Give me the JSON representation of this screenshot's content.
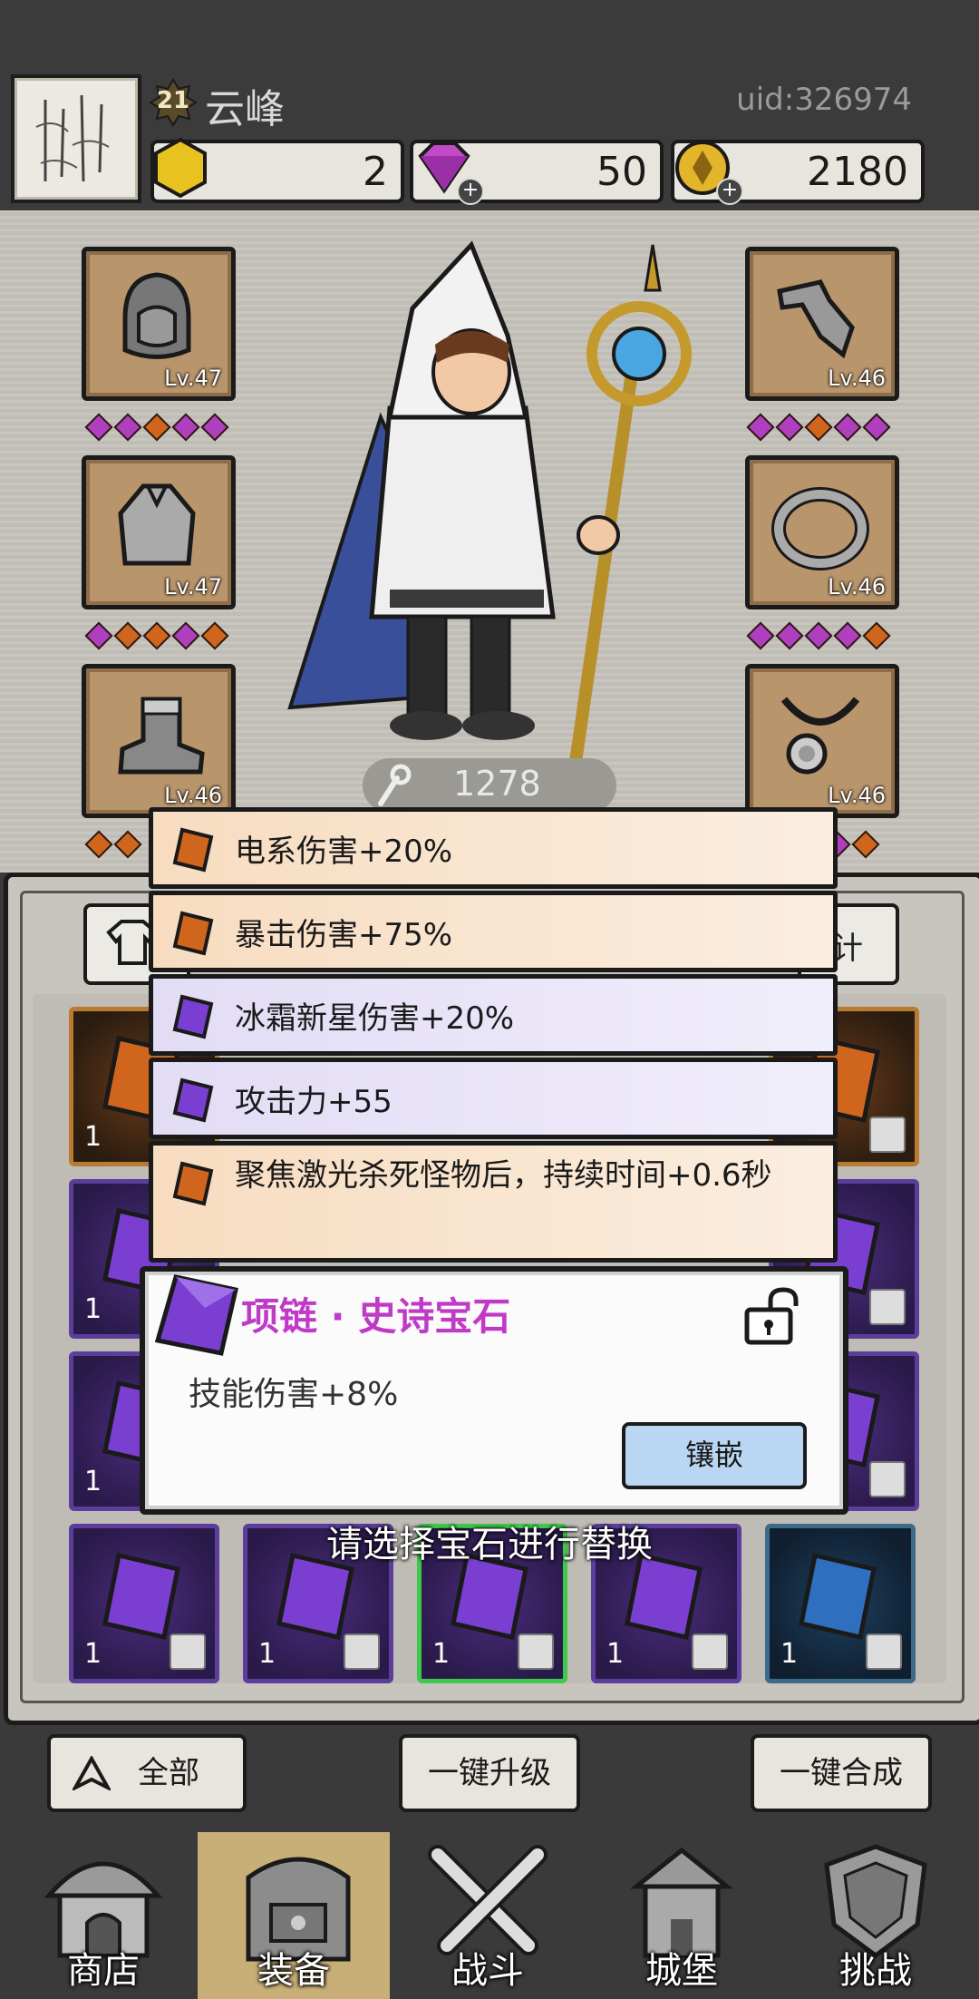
{
  "header": {
    "level": "21",
    "player_name": "云峰",
    "uid": "uid:326974",
    "resources": [
      {
        "icon": "gold-hexagon-icon",
        "value": "2"
      },
      {
        "icon": "diamond-icon",
        "value": "50"
      },
      {
        "icon": "coin-icon",
        "value": "2180"
      }
    ]
  },
  "equipment": {
    "left": [
      {
        "item": "helmet-icon",
        "level": "Lv.47",
        "dots": [
          "purple",
          "purple",
          "orange",
          "purple",
          "purple"
        ]
      },
      {
        "item": "cape-icon",
        "level": "Lv.47",
        "dots": [
          "purple",
          "orange",
          "orange",
          "purple",
          "orange"
        ]
      },
      {
        "item": "boot-icon",
        "level": "Lv.46",
        "dots": [
          "orange",
          "orange"
        ]
      }
    ],
    "right": [
      {
        "item": "bracer-icon",
        "level": "Lv.46",
        "dots": [
          "purple",
          "purple",
          "orange",
          "purple",
          "purple"
        ]
      },
      {
        "item": "ring-icon",
        "level": "Lv.46",
        "dots": [
          "purple",
          "purple",
          "purple",
          "purple",
          "orange"
        ]
      },
      {
        "item": "necklace-icon",
        "level": "Lv.46",
        "dots": [
          "purple",
          "orange"
        ]
      }
    ],
    "power": "1278"
  },
  "affixes": [
    {
      "color": "orange",
      "text": "电系伤害+20%"
    },
    {
      "color": "orange",
      "text": "暴击伤害+75%"
    },
    {
      "color": "purple",
      "text": "冰霜新星伤害+20%"
    },
    {
      "color": "purple",
      "text": "攻击力+55"
    },
    {
      "color": "orange",
      "text": "聚焦激光杀死怪物后，持续时间+0.6秒"
    }
  ],
  "inventory": {
    "tab_right_label": "计",
    "cells": [
      {
        "count": "1",
        "color": "orange"
      },
      {
        "count": "1",
        "color": "purple"
      },
      {
        "count": "1",
        "color": "purple"
      },
      {
        "count": "1",
        "color": "purple"
      },
      {
        "count": "1",
        "color": "purple"
      },
      {
        "count": "1",
        "color": "purple"
      },
      {
        "count": "1",
        "color": "purple"
      },
      {
        "count": "1",
        "color": "purple"
      },
      {
        "count": "1",
        "color": "purple"
      },
      {
        "count": "1",
        "color": "blue"
      }
    ]
  },
  "tooltip": {
    "title": "项链 · 史诗宝石",
    "description": "技能伤害+8%",
    "inlay_label": "镶嵌"
  },
  "hint": "请选择宝石进行替换",
  "actions": {
    "all_label": "全部",
    "upgrade_label": "一键升级",
    "combine_label": "一键合成"
  },
  "nav": [
    {
      "label": "商店",
      "icon": "shop-icon"
    },
    {
      "label": "装备",
      "icon": "backpack-icon"
    },
    {
      "label": "战斗",
      "icon": "crossed-swords-icon"
    },
    {
      "label": "城堡",
      "icon": "castle-icon"
    },
    {
      "label": "挑战",
      "icon": "shield-icon"
    }
  ],
  "colors": {
    "purple_gem": "#7a3fd0",
    "orange_gem": "#d0661e",
    "epic_title": "#c03ac8",
    "nav_active": "#c8ae77"
  }
}
